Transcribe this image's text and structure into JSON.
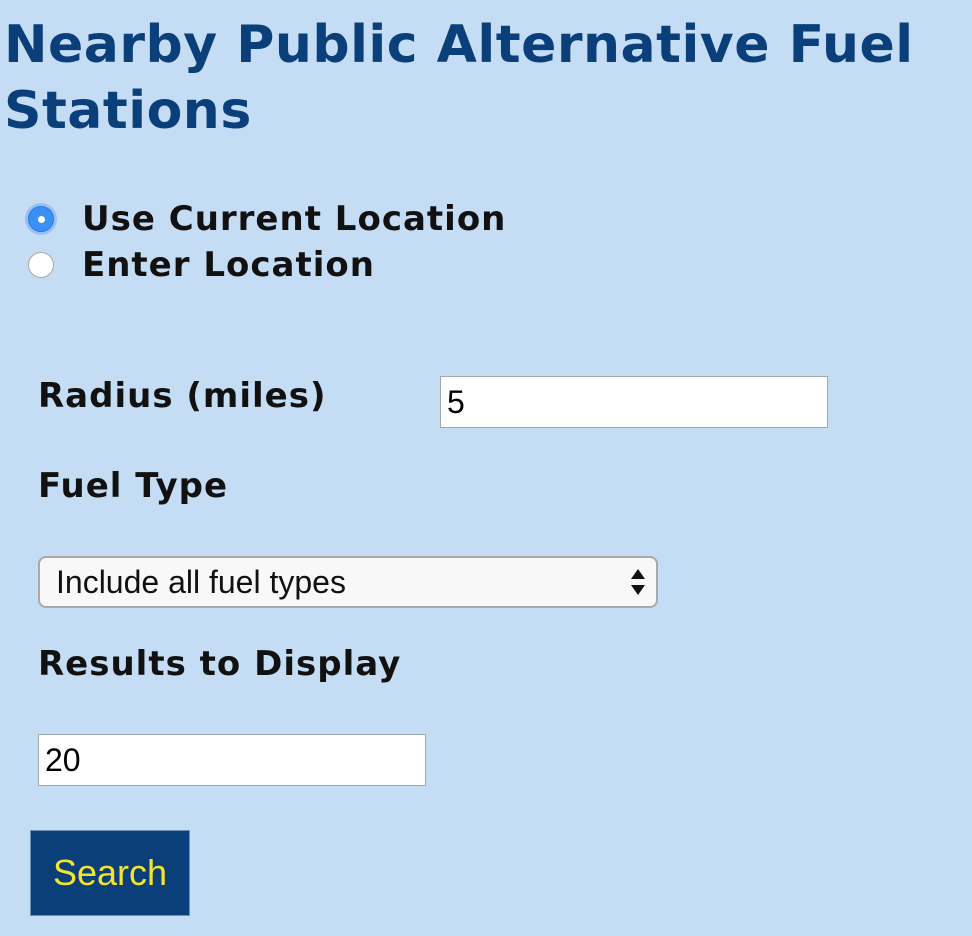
{
  "page": {
    "title": "Nearby Public Alternative Fuel Stations"
  },
  "location": {
    "options": [
      {
        "label": "Use Current Location",
        "selected": true
      },
      {
        "label": "Enter Location",
        "selected": false
      }
    ]
  },
  "radius": {
    "label": "Radius (miles)",
    "value": "5"
  },
  "fuel_type": {
    "label": "Fuel Type",
    "selected": "Include all fuel types"
  },
  "results": {
    "label": "Results to Display",
    "value": "20"
  },
  "search_button": {
    "label": "Search"
  },
  "colors": {
    "background": "#c5ddf4",
    "title": "#0a3f7a",
    "button_bg": "#0a3f7a",
    "button_text": "#f5e52a",
    "radio_selected": "#3b8ff5"
  }
}
